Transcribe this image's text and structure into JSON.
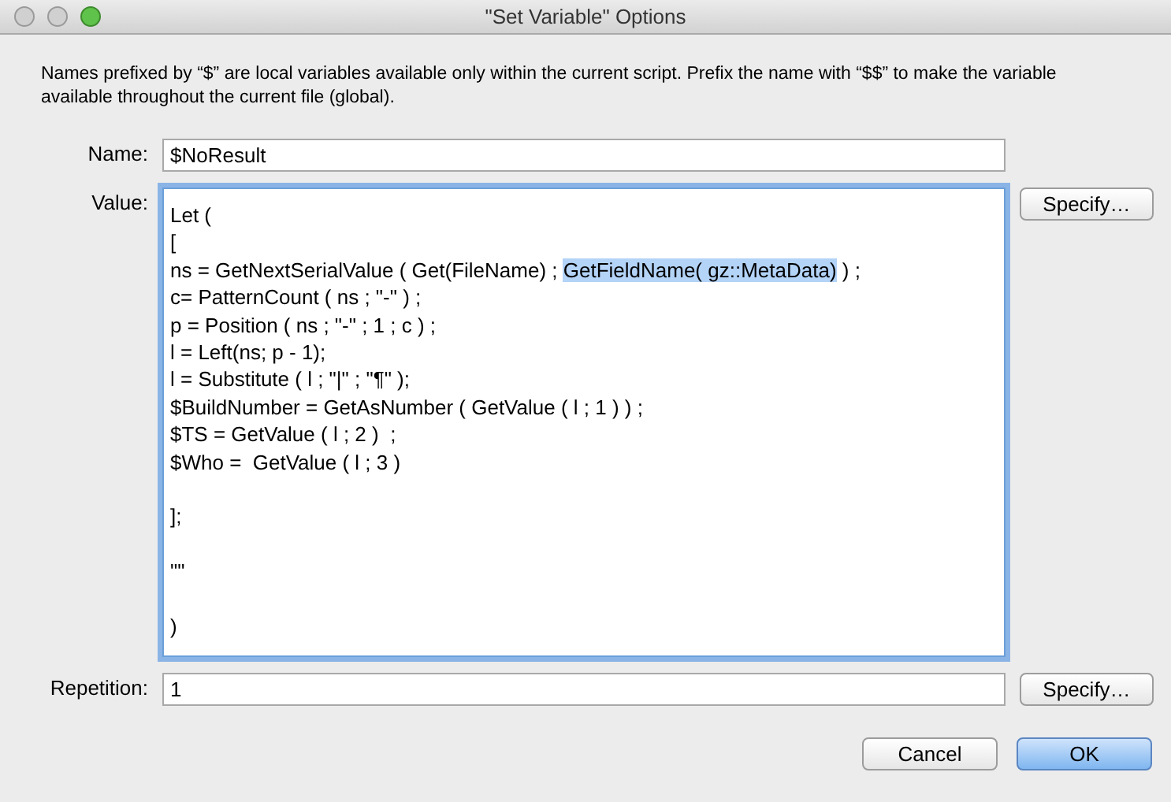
{
  "window": {
    "title": "\"Set Variable\" Options"
  },
  "description": "Names prefixed by “$” are local variables available only within the current script. Prefix the name with “$$” to make the variable available throughout the current file (global).",
  "name_field": {
    "label": "Name:",
    "value": "$NoResult"
  },
  "value_field": {
    "label": "Value:",
    "focused": true,
    "button": "Specify…",
    "lines": [
      {
        "blank_line_before": false,
        "segments": [
          {
            "text": "Let (",
            "selected": false
          }
        ]
      },
      {
        "blank_line_before": false,
        "segments": [
          {
            "text": "[",
            "selected": false
          }
        ]
      },
      {
        "blank_line_before": false,
        "segments": [
          {
            "text": "ns = GetNextSerialValue ( Get(FileName) ; ",
            "selected": false
          },
          {
            "text": "GetFieldName( gz::MetaData)",
            "selected": true
          },
          {
            "text": " ) ;",
            "selected": false
          }
        ]
      },
      {
        "blank_line_before": false,
        "segments": [
          {
            "text": "c= PatternCount ( ns ; \"-\" ) ;",
            "selected": false
          }
        ]
      },
      {
        "blank_line_before": false,
        "segments": [
          {
            "text": "p = Position ( ns ; \"-\" ; 1 ; c ) ;",
            "selected": false
          }
        ]
      },
      {
        "blank_line_before": false,
        "segments": [
          {
            "text": "l = Left(ns; p - 1);",
            "selected": false
          }
        ]
      },
      {
        "blank_line_before": false,
        "segments": [
          {
            "text": "l = Substitute ( l ; \"|\" ; \"¶\" );",
            "selected": false
          }
        ]
      },
      {
        "blank_line_before": false,
        "segments": [
          {
            "text": "$BuildNumber = GetAsNumber ( GetValue ( l ; 1 ) ) ;",
            "selected": false
          }
        ]
      },
      {
        "blank_line_before": false,
        "segments": [
          {
            "text": "$TS = GetValue ( l ; 2 )  ;",
            "selected": false
          }
        ]
      },
      {
        "blank_line_before": false,
        "segments": [
          {
            "text": "$Who =  GetValue ( l ; 3 )",
            "selected": false
          }
        ]
      },
      {
        "blank_line_before": true,
        "segments": [
          {
            "text": "];",
            "selected": false
          }
        ]
      },
      {
        "blank_line_before": true,
        "segments": [
          {
            "text": "\"\"",
            "selected": false
          }
        ]
      },
      {
        "blank_line_before": true,
        "segments": [
          {
            "text": ")",
            "selected": false
          }
        ]
      }
    ]
  },
  "repetition_field": {
    "label": "Repetition:",
    "value": "1",
    "button": "Specify…"
  },
  "buttons": [
    {
      "label": "Cancel",
      "default": false
    },
    {
      "label": "OK",
      "default": true
    }
  ]
}
